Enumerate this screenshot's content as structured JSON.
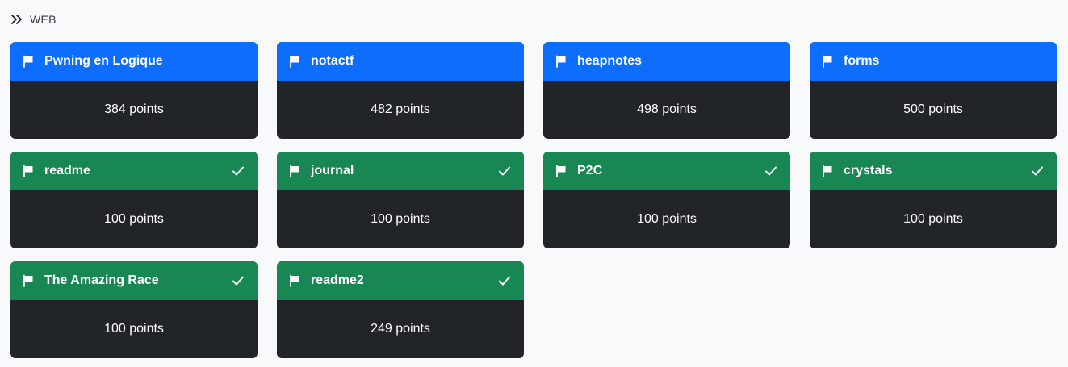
{
  "category": {
    "icon": "double-chevron-right-icon",
    "label": "WEB"
  },
  "colors": {
    "unsolved_header": "#0d6efd",
    "solved_header": "#198754",
    "card_body": "#212529",
    "page_background": "#f8f9fa"
  },
  "challenges": [
    {
      "name": "Pwning en Logique",
      "points": "384 points",
      "solved": false
    },
    {
      "name": "notactf",
      "points": "482 points",
      "solved": false
    },
    {
      "name": "heapnotes",
      "points": "498 points",
      "solved": false
    },
    {
      "name": "forms",
      "points": "500 points",
      "solved": false
    },
    {
      "name": "readme",
      "points": "100 points",
      "solved": true
    },
    {
      "name": "journal",
      "points": "100 points",
      "solved": true
    },
    {
      "name": "P2C",
      "points": "100 points",
      "solved": true
    },
    {
      "name": "crystals",
      "points": "100 points",
      "solved": true
    },
    {
      "name": "The Amazing Race",
      "points": "100 points",
      "solved": true
    },
    {
      "name": "readme2",
      "points": "249 points",
      "solved": true
    }
  ]
}
